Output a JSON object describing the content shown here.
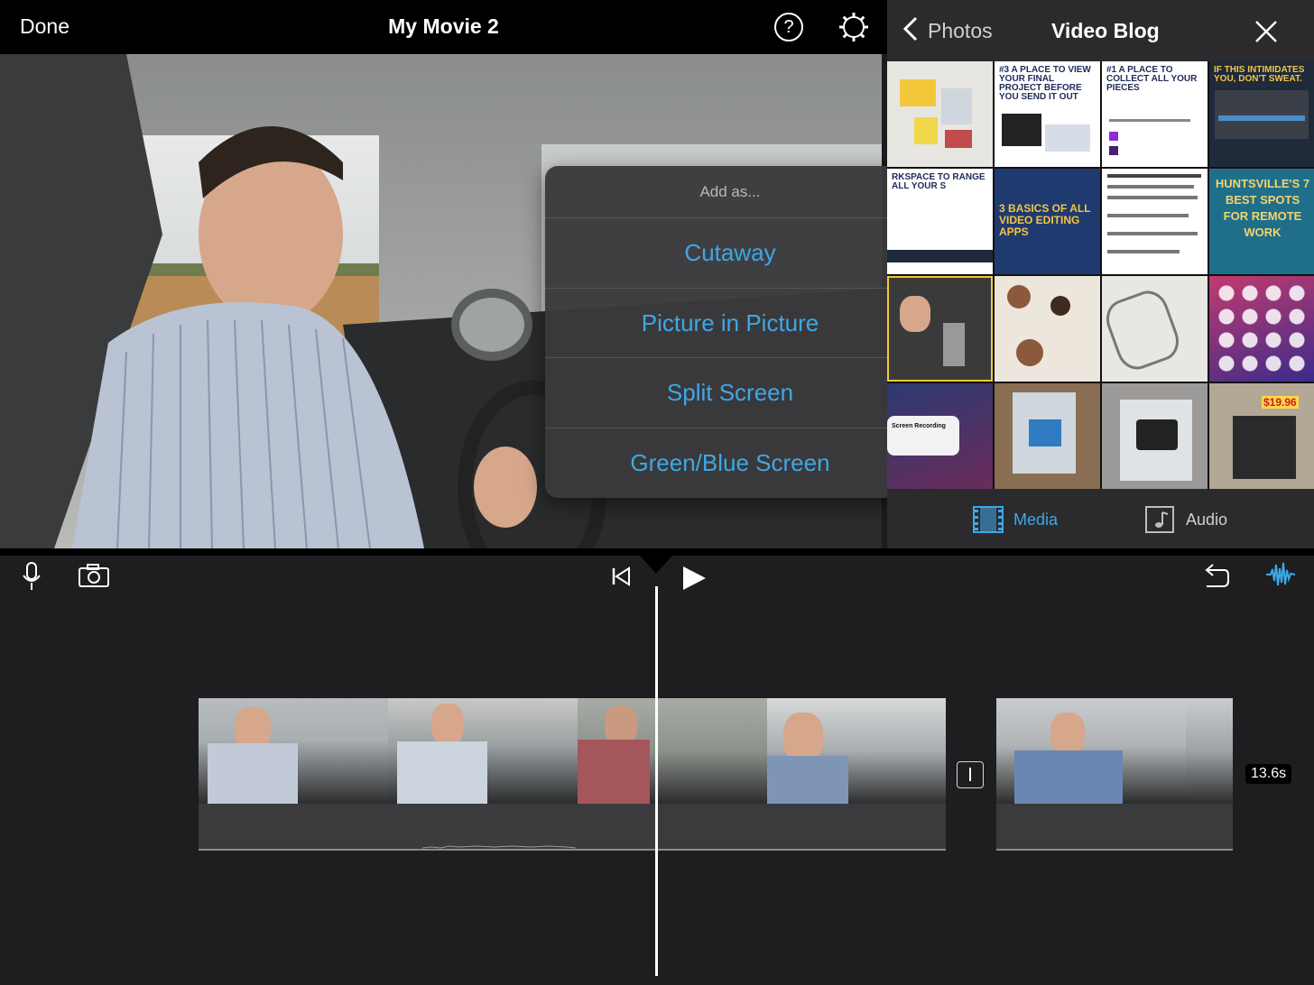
{
  "topbar": {
    "done_label": "Done",
    "project_title": "My Movie 2",
    "help_glyph": "?",
    "icons": [
      "help-icon",
      "gear-icon"
    ]
  },
  "popover": {
    "header": "Add as...",
    "options": [
      "Cutaway",
      "Picture in Picture",
      "Split Screen",
      "Green/Blue Screen"
    ],
    "option_color": "#3fa7e6"
  },
  "browser": {
    "back_label": "Photos",
    "album_title": "Video Blog",
    "thumbnails": [
      {
        "kind": "photo",
        "text": ""
      },
      {
        "kind": "slide",
        "text": "#3 A PLACE TO VIEW YOUR FINAL PROJECT BEFORE YOU SEND IT OUT"
      },
      {
        "kind": "slide",
        "text": "#1 A PLACE TO COLLECT ALL YOUR PIECES"
      },
      {
        "kind": "slide-dark",
        "text": "IF THIS INTIMIDATES YOU, DON'T SWEAT."
      },
      {
        "kind": "slide",
        "text": "RKSPACE TO RANGE ALL YOUR S"
      },
      {
        "kind": "slide-blue",
        "text": "3 BASICS OF ALL VIDEO EDITING APPS"
      },
      {
        "kind": "slide",
        "text": ""
      },
      {
        "kind": "slide-teal",
        "text": "HUNTSVILLE'S 7 BEST SPOTS FOR REMOTE WORK"
      },
      {
        "kind": "photo",
        "text": ""
      },
      {
        "kind": "photo",
        "text": ""
      },
      {
        "kind": "photo",
        "text": ""
      },
      {
        "kind": "app-grid",
        "text": ""
      },
      {
        "kind": "app-grid",
        "text": "Screen Recording"
      },
      {
        "kind": "photo",
        "text": ""
      },
      {
        "kind": "photo",
        "text": ""
      },
      {
        "kind": "photo",
        "text": "$19.96"
      }
    ],
    "tabs": [
      {
        "label": "Media",
        "active": true,
        "icon": "film-icon"
      },
      {
        "label": "Audio",
        "active": false,
        "icon": "music-note-icon"
      }
    ],
    "active_color": "#3fa7e6"
  },
  "timeline": {
    "icons": [
      "microphone-icon",
      "camera-icon",
      "skip-to-start-icon",
      "play-icon",
      "undo-icon",
      "audio-waveform-icon"
    ],
    "clip_duration": "13.6s"
  }
}
